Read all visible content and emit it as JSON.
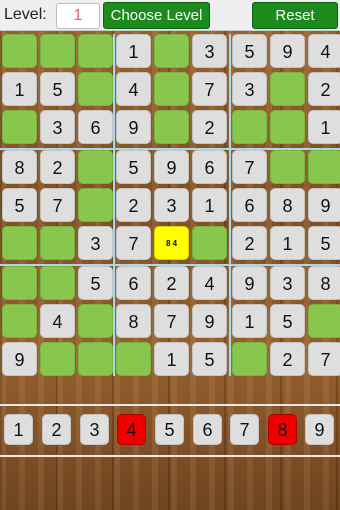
{
  "header": {
    "level_label": "Level:",
    "level_value": "1",
    "choose_level_label": "Choose Level",
    "reset_label": "Reset"
  },
  "board": {
    "rows": [
      [
        "",
        "",
        "",
        "1",
        "",
        "3",
        "5",
        "9",
        "4"
      ],
      [
        "1",
        "5",
        "",
        "4",
        "",
        "7",
        "3",
        "",
        "2"
      ],
      [
        "",
        "3",
        "6",
        "9",
        "",
        "2",
        "",
        "",
        "1"
      ],
      [
        "8",
        "2",
        "",
        "5",
        "9",
        "6",
        "7",
        "",
        ""
      ],
      [
        "5",
        "7",
        "",
        "2",
        "3",
        "1",
        "6",
        "8",
        "9"
      ],
      [
        "",
        "",
        "3",
        "7",
        "8 4",
        "",
        "2",
        "1",
        "5"
      ],
      [
        "",
        "",
        "5",
        "6",
        "2",
        "4",
        "9",
        "3",
        "8"
      ],
      [
        "",
        "4",
        "",
        "8",
        "7",
        "9",
        "1",
        "5",
        ""
      ],
      [
        "9",
        "",
        "",
        "",
        "1",
        "5",
        "",
        "2",
        "7"
      ]
    ],
    "selected_cell": {
      "row": 5,
      "col": 4,
      "notes": "8 4"
    }
  },
  "number_pad": {
    "keys": [
      "1",
      "2",
      "3",
      "4",
      "5",
      "6",
      "7",
      "8",
      "9"
    ],
    "completed": [
      "4",
      "8"
    ],
    "completed_color": "#ee0000"
  },
  "colors": {
    "given_cell": "#dedede",
    "empty_cell": "#88c64d",
    "selected_cell": "#ffff00",
    "button_green": "#1c8a1c",
    "grid_line": "#a6d8ee"
  }
}
